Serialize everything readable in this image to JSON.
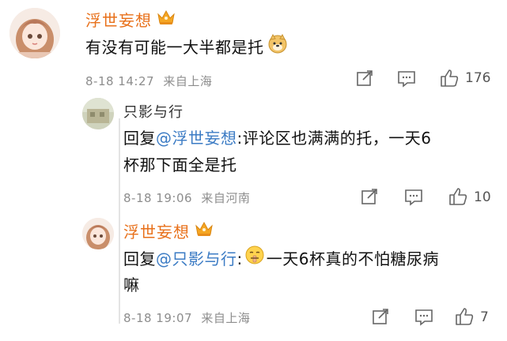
{
  "comment": {
    "user": "浮世妄想",
    "text": "有没有可能一大半都是托",
    "emoji": "doge-emoji",
    "date": "8-18 14:27",
    "location": "来自上海",
    "likes": "176"
  },
  "replies": [
    {
      "user": "只影与行",
      "reply_prefix": "回复",
      "mention": "@浮世妄想",
      "line1": ":评论区也满满的托，一天6",
      "line2": "杯那下面全是托",
      "date": "8-18 19:06",
      "location": "来自河南",
      "likes": "10"
    },
    {
      "user": "浮世妄想",
      "reply_prefix": "回复",
      "mention": "@只影与行",
      "line1": "一天6杯真的不怕糖尿病",
      "line2": "嘛",
      "emoji": "shush-emoji",
      "date": "8-18 19:07",
      "location": "来自上海",
      "likes": "7"
    }
  ],
  "icons": {
    "share": "share-icon",
    "comment": "comment-icon",
    "like": "thumbs-up-icon",
    "vip": "crown-icon"
  },
  "colors": {
    "vip_name": "#e8701a",
    "mention": "#3b7bc4",
    "meta": "#8d8d8d"
  }
}
